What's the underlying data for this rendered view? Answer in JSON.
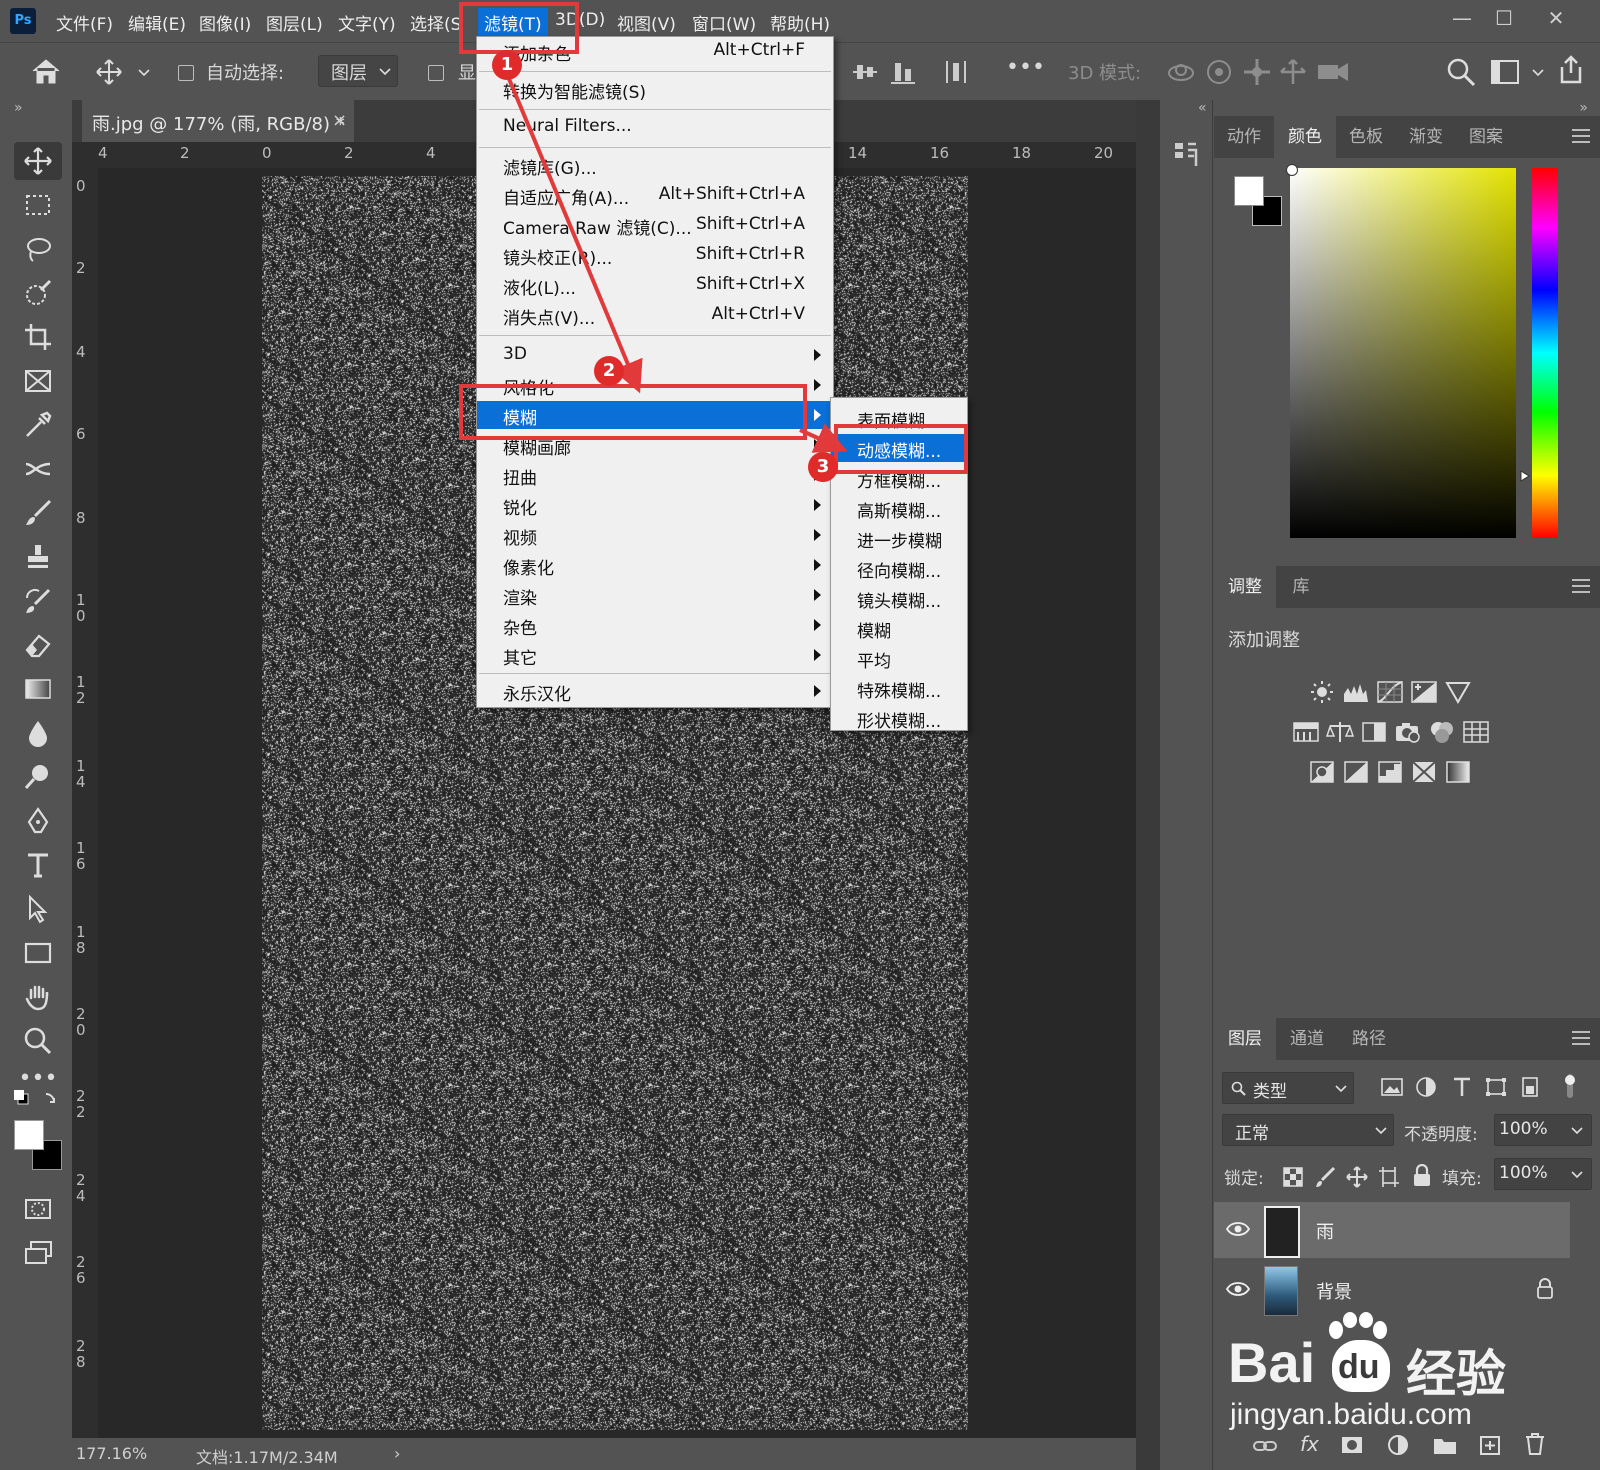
{
  "app": {
    "logo": "Ps"
  },
  "menubar": {
    "items": [
      "文件(F)",
      "编辑(E)",
      "图像(I)",
      "图层(L)",
      "文字(Y)",
      "选择(S",
      "滤镜(T)",
      "3D(D)",
      "视图(V)",
      "窗口(W)",
      "帮助(H)"
    ]
  },
  "window_controls": {
    "minimize": "—",
    "maximize": "☐",
    "close": "✕"
  },
  "options_bar": {
    "auto_select_label": "自动选择:",
    "layer_dropdown": "图层",
    "show_label": "显",
    "mode_3d_label": "3D 模式:",
    "more": "•••"
  },
  "document": {
    "tab_title": "雨.jpg @ 177% (雨, RGB/8) *",
    "close": "×",
    "ruler_h": [
      "4",
      "2",
      "0",
      "2",
      "4",
      "14",
      "16",
      "18",
      "20"
    ],
    "ruler_v": [
      "0",
      "2",
      "4",
      "6",
      "8",
      "10",
      "12",
      "14",
      "16",
      "18",
      "20",
      "22",
      "24",
      "26",
      "28"
    ],
    "zoom": "177.16%",
    "doc_info": "文档:1.17M/2.34M",
    "status_arrow": "›"
  },
  "filter_menu": {
    "items": [
      {
        "label": "添加杂色",
        "shortcut": "Alt+Ctrl+F"
      },
      {
        "label": "转换为智能滤镜(S)",
        "shortcut": ""
      },
      {
        "label": "Neural Filters...",
        "shortcut": ""
      },
      {
        "label": "滤镜库(G)...",
        "shortcut": ""
      },
      {
        "label": "自适应广角(A)...",
        "shortcut": "Alt+Shift+Ctrl+A"
      },
      {
        "label": "Camera Raw 滤镜(C)...",
        "shortcut": "Shift+Ctrl+A"
      },
      {
        "label": "镜头校正(R)...",
        "shortcut": "Shift+Ctrl+R"
      },
      {
        "label": "液化(L)...",
        "shortcut": "Shift+Ctrl+X"
      },
      {
        "label": "消失点(V)...",
        "shortcut": "Alt+Ctrl+V"
      },
      {
        "label": "3D",
        "shortcut": ""
      },
      {
        "label": "风格化",
        "shortcut": ""
      },
      {
        "label": "模糊",
        "shortcut": ""
      },
      {
        "label": "模糊画廊",
        "shortcut": ""
      },
      {
        "label": "扭曲",
        "shortcut": ""
      },
      {
        "label": "锐化",
        "shortcut": ""
      },
      {
        "label": "视频",
        "shortcut": ""
      },
      {
        "label": "像素化",
        "shortcut": ""
      },
      {
        "label": "渲染",
        "shortcut": ""
      },
      {
        "label": "杂色",
        "shortcut": ""
      },
      {
        "label": "其它",
        "shortcut": ""
      },
      {
        "label": "永乐汉化",
        "shortcut": ""
      }
    ]
  },
  "blur_submenu": {
    "items": [
      "表面模糊...",
      "动感模糊...",
      "方框模糊...",
      "高斯模糊...",
      "进一步模糊",
      "径向模糊...",
      "镜头模糊...",
      "模糊",
      "平均",
      "特殊模糊...",
      "形状模糊..."
    ]
  },
  "annotations": {
    "step1": "1",
    "step2": "2",
    "step3": "3",
    "color": "#e23a3a"
  },
  "color_panel": {
    "tabs": [
      "动作",
      "颜色",
      "色板",
      "渐变",
      "图案"
    ],
    "active_tab": "颜色",
    "foreground": "#ffffff",
    "background": "#000000"
  },
  "adjustments_panel": {
    "tabs": [
      "调整",
      "库"
    ],
    "title": "添加调整"
  },
  "layers_panel": {
    "tabs": [
      "图层",
      "通道",
      "路径"
    ],
    "filter_kind": "类型",
    "blend_mode": "正常",
    "opacity_label": "不透明度:",
    "opacity": "100%",
    "lock_label": "锁定:",
    "fill_label": "填充:",
    "fill": "100%",
    "layers": [
      {
        "name": "雨",
        "selected": true
      },
      {
        "name": "背景",
        "locked": true
      }
    ],
    "footer": "fx"
  },
  "watermark": {
    "brand": "Bai",
    "brand2": "du",
    "cn": "经验",
    "url": "jingyan.baidu.com"
  },
  "ui_colors": {
    "accent": "#0a6fd6",
    "panel": "#535353",
    "dark": "#282828",
    "menu_bg": "#f0f0f0"
  }
}
